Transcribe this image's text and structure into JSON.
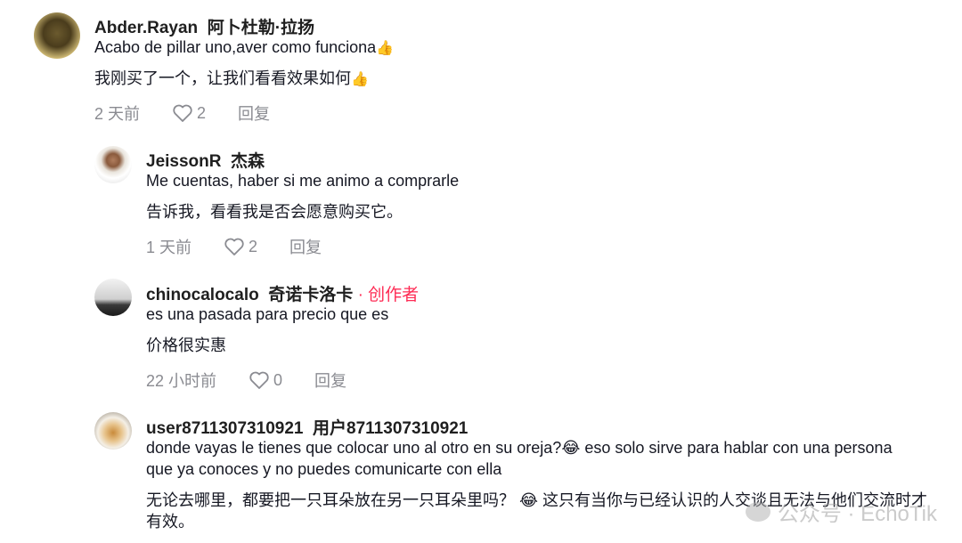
{
  "comments": [
    {
      "username": "Abder.Rayan",
      "username_cn": "阿卜杜勒·拉扬",
      "text": "Acabo de pillar uno,aver como funciona",
      "emoji": "👍",
      "translation": "我刚买了一个，让我们看看效果如何",
      "translation_emoji": "👍",
      "time": "2 天前",
      "likes": "2",
      "reply": "回复"
    },
    {
      "username": "JeissonR",
      "username_cn": "杰森",
      "text": "Me cuentas, haber si me animo a comprarle",
      "translation": "告诉我，看看我是否会愿意购买它。",
      "time": "1 天前",
      "likes": "2",
      "reply": "回复"
    },
    {
      "username": "chinocalocalo",
      "username_cn": "奇诺卡洛卡",
      "author_tag": "· 创作者",
      "text": "es una pasada para precio que es",
      "translation": "价格很实惠",
      "time": "22 小时前",
      "likes": "0",
      "reply": "回复"
    },
    {
      "username": "user8711307310921",
      "username_cn": "用户8711307310921",
      "text_line1": "donde vayas le tienes que colocar uno al otro en su oreja?",
      "text_line1_emoji": "😂",
      "text_line1_after": " eso solo sirve para hablar con una persona",
      "text_line2": "que ya conoces y no puedes comunicarte con ella",
      "translation_line1_a": "无论去哪里，都要把一只耳朵放在另一只耳朵里吗？ ",
      "translation_line1_emoji": "😂",
      "translation_line1_b": " 这只有当你与已经认识的人交谈且无法与他们交流时才",
      "translation_line2": "有效。"
    }
  ],
  "watermark": "公众号 · EchoTik"
}
